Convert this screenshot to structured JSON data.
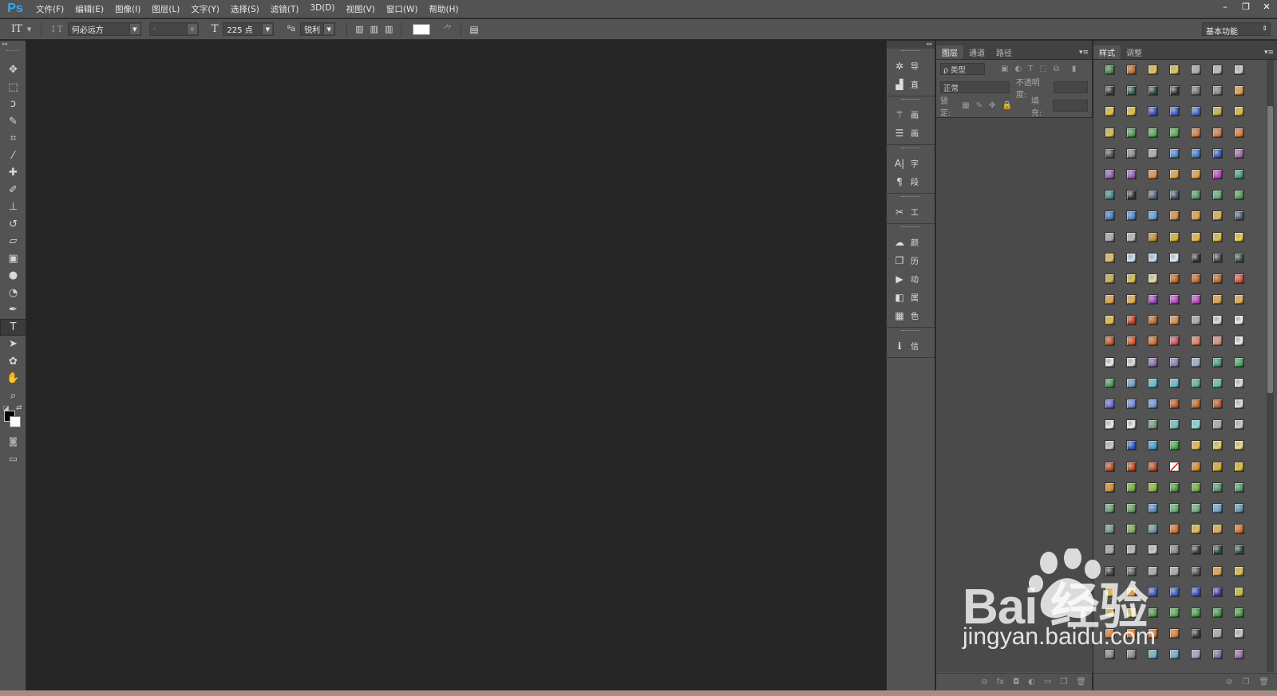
{
  "app": {
    "logo": "Ps"
  },
  "menu": [
    "文件(F)",
    "编辑(E)",
    "图像(I)",
    "图层(L)",
    "文字(Y)",
    "选择(S)",
    "滤镜(T)",
    "3D(D)",
    "视图(V)",
    "窗口(W)",
    "帮助(H)"
  ],
  "window_controls": {
    "minimize": "–",
    "restore": "❐",
    "close": "✕"
  },
  "options": {
    "tool_glyph": "IT",
    "orient_glyph": "↕T",
    "font_family": "何必远方",
    "font_style": "-",
    "size_glyph": "T",
    "font_size": "225 点",
    "aa_glyph": "ªa",
    "antialias": "锐利",
    "text_color": "#ffffff",
    "workspace": "基本功能"
  },
  "tools": [
    {
      "name": "move-tool",
      "icon": "✥"
    },
    {
      "name": "marquee-tool",
      "icon": "⬚"
    },
    {
      "name": "lasso-tool",
      "icon": "ↄ"
    },
    {
      "name": "quick-select-tool",
      "icon": "✎"
    },
    {
      "name": "crop-tool",
      "icon": "⌗"
    },
    {
      "name": "eyedropper-tool",
      "icon": "⁄"
    },
    {
      "name": "healing-tool",
      "icon": "✚"
    },
    {
      "name": "brush-tool",
      "icon": "✐"
    },
    {
      "name": "stamp-tool",
      "icon": "⊥"
    },
    {
      "name": "history-brush-tool",
      "icon": "↺"
    },
    {
      "name": "eraser-tool",
      "icon": "▱"
    },
    {
      "name": "gradient-tool",
      "icon": "▣"
    },
    {
      "name": "blur-tool",
      "icon": "●"
    },
    {
      "name": "dodge-tool",
      "icon": "◔"
    },
    {
      "name": "pen-tool",
      "icon": "✒"
    },
    {
      "name": "type-tool",
      "icon": "T",
      "selected": true
    },
    {
      "name": "path-select-tool",
      "icon": "➤"
    },
    {
      "name": "shape-tool",
      "icon": "✿"
    },
    {
      "name": "hand-tool",
      "icon": "✋"
    },
    {
      "name": "zoom-tool",
      "icon": "⌕"
    }
  ],
  "dock": {
    "groups": [
      [
        {
          "icon": "✲",
          "label": "导"
        },
        {
          "icon": "▟",
          "label": "直"
        }
      ],
      [
        {
          "icon": "⚚",
          "label": "画"
        },
        {
          "icon": "☰",
          "label": "画"
        }
      ],
      [
        {
          "icon": "A|",
          "label": "字"
        },
        {
          "icon": "¶",
          "label": "段"
        }
      ],
      [
        {
          "icon": "✂",
          "label": "工"
        }
      ],
      [
        {
          "icon": "☁",
          "label": "颜"
        },
        {
          "icon": "❐",
          "label": "历"
        },
        {
          "icon": "▶",
          "label": "动"
        },
        {
          "icon": "◧",
          "label": "属"
        },
        {
          "icon": "▦",
          "label": "色"
        }
      ],
      [
        {
          "icon": "ℹ",
          "label": "信"
        }
      ]
    ]
  },
  "layers_panel": {
    "tabs": [
      "图层",
      "通道",
      "路径"
    ],
    "filter_label": "ρ 类型",
    "blend_mode": "正常",
    "opacity_label": "不透明度:",
    "lock_label": "锁定:",
    "fill_label": "填充:",
    "footer_icons": [
      "⊖",
      "fx",
      "◘",
      "◐",
      "▭",
      "❐",
      "🗑"
    ]
  },
  "styles_panel": {
    "tabs": [
      "样式",
      "调整"
    ],
    "footer_icons": [
      "⊘",
      "❐",
      "🗑"
    ],
    "colors": [
      "#3d8a3d",
      "#c86a1e",
      "#e8c640",
      "#e6c640",
      "#aaaaaa",
      "#bbbbbb",
      "#cccccc",
      "#3a3a3a",
      "#2f5d56",
      "#2f4a46",
      "#3a3a3a",
      "#777777",
      "#888888",
      "#e8a03a",
      "#e8c032",
      "#e8c436",
      "#3a4acd",
      "#3a5ad0",
      "#3d6bd4",
      "#c8b43a",
      "#e0c02a",
      "#d8c43a",
      "#4aa04a",
      "#4ab04a",
      "#4ab04a",
      "#e07a30",
      "#e07a30",
      "#e07a30",
      "#555555",
      "#888888",
      "#aaaaaa",
      "#4a8ad8",
      "#3a7ad0",
      "#3a5ac8",
      "#9a6ab0",
      "#9a5ab8",
      "#9a5ab8",
      "#e88a3a",
      "#e8a03a",
      "#e8a03a",
      "#c83ac8",
      "#3aa070",
      "#3a8a88",
      "#333333",
      "#556677",
      "#445566",
      "#4a9a5a",
      "#5ab06a",
      "#4aa04a",
      "#3a7ad0",
      "#4a8ad8",
      "#5aa0e0",
      "#e08a3a",
      "#e8a03a",
      "#e8b040",
      "#4a5a6a",
      "#aaaaaa",
      "#bbbbbb",
      "#c8901a",
      "#e0b020",
      "#e8c032",
      "#e8c032",
      "#f0d040",
      "#e8c050",
      "#d0e0ff",
      "#c0e0ff",
      "#e0f0ff",
      "#333333",
      "#444444",
      "#3a4a4a",
      "#c8b43a",
      "#d8c43a",
      "#e8e0a0",
      "#c8661a",
      "#c8661a",
      "#c8661a",
      "#e84a3a",
      "#e8a03a",
      "#e8b040",
      "#a040c8",
      "#c040c8",
      "#c040c8",
      "#e8a03a",
      "#e8b040",
      "#e8c032",
      "#c83a1a",
      "#c8661a",
      "#e08a3a",
      "#aaaaaa",
      "#dddddd",
      "#eeeeee",
      "#c8561a",
      "#e0561a",
      "#e06a1a",
      "#d84a5a",
      "#e87a5a",
      "#e88a7a",
      "#eeeeee",
      "#eeeeee",
      "#dddddd",
      "#8a6ab0",
      "#8a7ab8",
      "#a0b0d0",
      "#3aa070",
      "#3ab060",
      "#3aa050",
      "#6aa0d0",
      "#5ac0d8",
      "#5ac0d0",
      "#5ab0a0",
      "#5ac0b0",
      "#e0e0e0",
      "#6a6ae0",
      "#6a8ae0",
      "#6a9ae0",
      "#c8561a",
      "#c8661a",
      "#c8561a",
      "#e0e0e0",
      "#eeeeee",
      "#eeeeee",
      "#6aa070",
      "#70c0c0",
      "#80e0e0",
      "#aaaaaa",
      "#cccccc",
      "#cccccc",
      "#2a5ad0",
      "#3aa0e0",
      "#3ab03a",
      "#e8c040",
      "#e8d060",
      "#f0e080",
      "#c8461a",
      "#c8461a",
      "#c8461a",
      "#ffffff",
      "#e08a1a",
      "#e0b020",
      "#e8c020",
      "#e08a1a",
      "#6ab030",
      "#8ac020",
      "#4a9a30",
      "#6ab030",
      "#4a9a6a",
      "#4aa060",
      "#6aa070",
      "#6aa060",
      "#5a8ad0",
      "#5ab06a",
      "#6ab07a",
      "#6aa0d0",
      "#5a9ab0",
      "#6a9a8a",
      "#7ab050",
      "#5a9aa0",
      "#e8661a",
      "#e8c040",
      "#e8b030",
      "#e8661a",
      "#aaaaaa",
      "#bbbbbb",
      "#cccccc",
      "#888888",
      "#3a3a3a",
      "#2a4a4a",
      "#2a4a4a",
      "#444444",
      "#666666",
      "#aaaaaa",
      "#aaaaaa",
      "#555555",
      "#e8a03a",
      "#e8c040",
      "#e8c040",
      "#e8a03a",
      "#3a5ad0",
      "#3a5ad0",
      "#3a4ad0",
      "#3a3ab0",
      "#c8c030",
      "#e8c040",
      "#e8c040",
      "#4aa04a",
      "#4ab04a",
      "#3aa03a",
      "#3aa03a",
      "#3aa03a",
      "#e07a30",
      "#e07a30",
      "#e07a30",
      "#e07a30",
      "#3a3a3a",
      "#aaaaaa",
      "#cccccc",
      "#888888",
      "#888888",
      "#6ab0d0",
      "#6ab0d0",
      "#a0a0c0",
      "#8a6ab0",
      "#9a6ab0"
    ]
  },
  "watermark": {
    "line1": "Bai 经验",
    "line2": "jingyan.baidu.com"
  }
}
